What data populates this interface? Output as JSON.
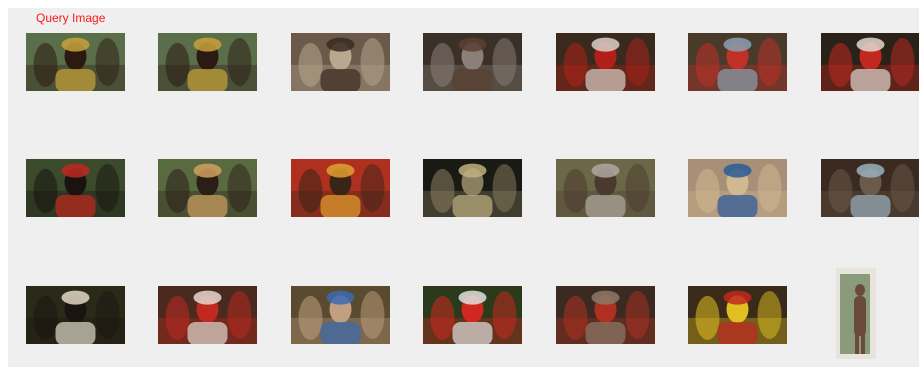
{
  "header": {
    "query_label": "Query Image"
  },
  "results": [
    {
      "subject": "woman-portrait",
      "palette": [
        "#5a6e4a",
        "#2b1a12",
        "#c9a23a"
      ]
    },
    {
      "subject": "woman-portrait",
      "palette": [
        "#5a6e4a",
        "#2b1a12",
        "#c9a23a"
      ]
    },
    {
      "subject": "painted-face-elder",
      "palette": [
        "#6b5a4a",
        "#b8a890",
        "#3a2a20"
      ]
    },
    {
      "subject": "elder-grey-hair",
      "palette": [
        "#3a3028",
        "#8a8078",
        "#5a4030"
      ]
    },
    {
      "subject": "headdress-red-feathers",
      "palette": [
        "#3a2a1e",
        "#b02018",
        "#d8d0c8"
      ]
    },
    {
      "subject": "group-smiling",
      "palette": [
        "#4a3a2a",
        "#c03028",
        "#8aa0b0"
      ]
    },
    {
      "subject": "headdress-red-feathers",
      "palette": [
        "#2a2218",
        "#c02820",
        "#e0d8d0"
      ]
    },
    {
      "subject": "headdress-dark",
      "palette": [
        "#3a4a2a",
        "#1a1410",
        "#c02820"
      ]
    },
    {
      "subject": "woman-portrait",
      "palette": [
        "#5a6a40",
        "#2a1e16",
        "#d0a060"
      ]
    },
    {
      "subject": "mother-child",
      "palette": [
        "#b03020",
        "#3a2418",
        "#e0a030"
      ]
    },
    {
      "subject": "fountain-night",
      "palette": [
        "#1a1a14",
        "#8a8060",
        "#c0b080"
      ]
    },
    {
      "subject": "two-elders",
      "palette": [
        "#6a6848",
        "#4a3a2e",
        "#b0a8a0"
      ]
    },
    {
      "subject": "beach-figure",
      "palette": [
        "#a89078",
        "#d0b890",
        "#2a5a9a"
      ]
    },
    {
      "subject": "crowd",
      "palette": [
        "#3a2a20",
        "#6a5a4a",
        "#9ab0c0"
      ]
    },
    {
      "subject": "headdress-dark",
      "palette": [
        "#2a2a18",
        "#1a1410",
        "#e0d8c8"
      ]
    },
    {
      "subject": "dancers-red",
      "palette": [
        "#4a2a1e",
        "#c02820",
        "#e0d8d0"
      ]
    },
    {
      "subject": "masked-pair",
      "palette": [
        "#5a4a30",
        "#c0a080",
        "#3a6ab0"
      ]
    },
    {
      "subject": "painted-mask-red",
      "palette": [
        "#2a3a1a",
        "#d02820",
        "#e0e0e0"
      ]
    },
    {
      "subject": "bearded-man",
      "palette": [
        "#3a2a22",
        "#b03020",
        "#8a7a68"
      ]
    },
    {
      "subject": "painted-mask-yellow",
      "palette": [
        "#3a2a1a",
        "#e0c020",
        "#c02820"
      ]
    },
    {
      "subject": "standing-figure-doorway",
      "palette": [
        "#e8e4dc",
        "#6a4a38",
        "#4a6a3a"
      ]
    }
  ]
}
